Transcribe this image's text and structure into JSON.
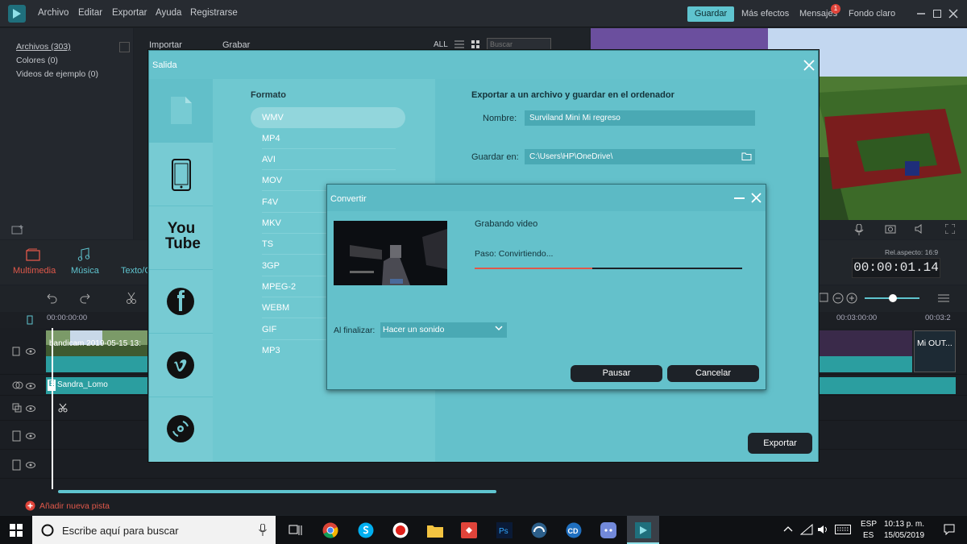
{
  "menubar": {
    "items": [
      "Archivo",
      "Editar",
      "Exportar",
      "Ayuda",
      "Registrarse"
    ],
    "save": "Guardar",
    "more_effects": "Más efectos",
    "messages": "Mensajes",
    "messages_count": "1",
    "theme": "Fondo claro"
  },
  "library": {
    "items": [
      "Archivos (303)",
      "Colores (0)",
      "Videos de ejemplo (0)"
    ],
    "import": "Importar",
    "record": "Grabar",
    "filter_all": "ALL",
    "search_placeholder": "Buscar"
  },
  "tabs": [
    "Multimedia",
    "Música",
    "Texto/C"
  ],
  "preview": {
    "aspect": "Rel.aspecto: 16:9",
    "timecode": "00:00:01.14"
  },
  "timeline": {
    "ruler": [
      "00:00:00:00",
      "00:03:00:00",
      "00:03:2"
    ],
    "clip_main": "bandicam 2019-05-15 13:",
    "clip_end": "Mi OUT...",
    "text_clip": "Sandra_Lomo",
    "add_track": "Añadir nueva pista"
  },
  "salida": {
    "title": "Salida",
    "format_label": "Formato",
    "formats": [
      "WMV",
      "MP4",
      "AVI",
      "MOV",
      "F4V",
      "MKV",
      "TS",
      "3GP",
      "MPEG-2",
      "WEBM",
      "GIF",
      "MP3"
    ],
    "selected_format": "WMV",
    "export_heading": "Exportar a un archivo y guardar en el ordenador",
    "name_label": "Nombre:",
    "name_value": "Surviland Mini Mi regreso",
    "save_in_label": "Guardar en:",
    "save_in_value": "C:\\Users\\HP\\OneDrive\\",
    "export_button": "Exportar",
    "side_youtube": "You Tube"
  },
  "convertir": {
    "title": "Convertir",
    "status": "Grabando video",
    "step": "Paso: Convirtiendo...",
    "progress": 0.44,
    "on_finish_label": "Al finalizar:",
    "on_finish_value": "Hacer un sonido",
    "pause": "Pausar",
    "cancel": "Cancelar"
  },
  "taskbar": {
    "search": "Escribe aquí para buscar",
    "lang": "ESP",
    "lang2": "ES",
    "time": "10:13 p. m.",
    "date": "15/05/2019"
  },
  "colors": {
    "accent": "#5fc4cf",
    "progress_fill": "#e0584a",
    "record": "#e0443a"
  }
}
